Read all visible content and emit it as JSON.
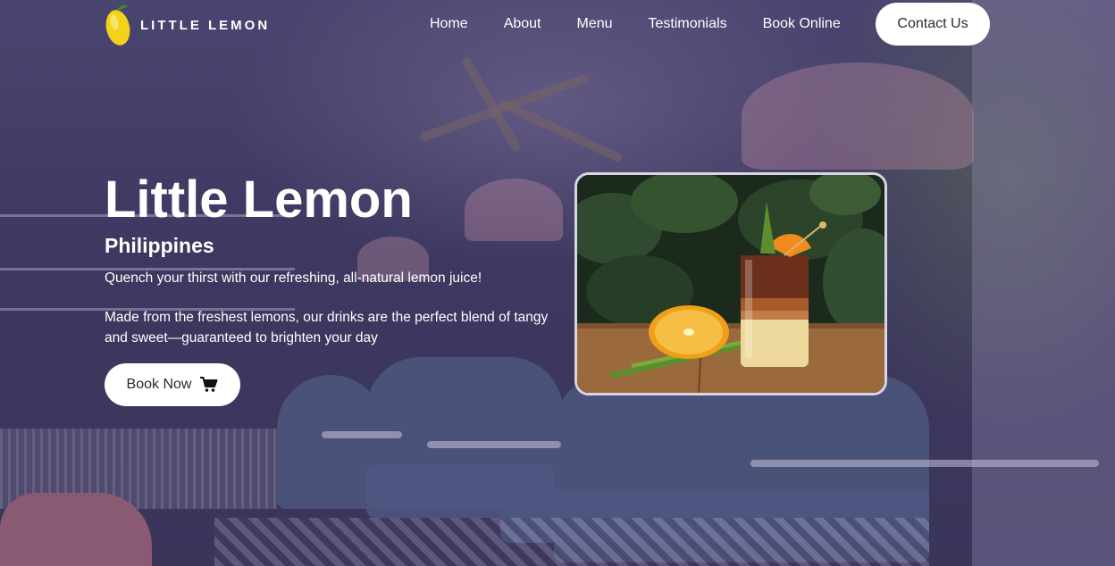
{
  "brand": {
    "name": "LITTLE LEMON",
    "logo_icon": "lemon-icon",
    "logo_color": "#f2d21b"
  },
  "nav": {
    "items": [
      {
        "label": "Home"
      },
      {
        "label": "About"
      },
      {
        "label": "Menu"
      },
      {
        "label": "Testimonials"
      },
      {
        "label": "Book Online"
      }
    ],
    "contact_label": "Contact Us"
  },
  "hero": {
    "title": "Little Lemon",
    "subtitle": "Philippines",
    "tagline": "Quench your thirst with our refreshing, all-natural lemon juice!",
    "description": "Made from the freshest lemons, our drinks are the perfect blend of tangy and sweet—guaranteed to brighten your day",
    "cta_label": "Book Now",
    "cta_icon": "cart-icon"
  },
  "colors": {
    "overlay": "#3f3a63",
    "button_bg": "#ffffff",
    "button_text": "#2b2b2b"
  }
}
